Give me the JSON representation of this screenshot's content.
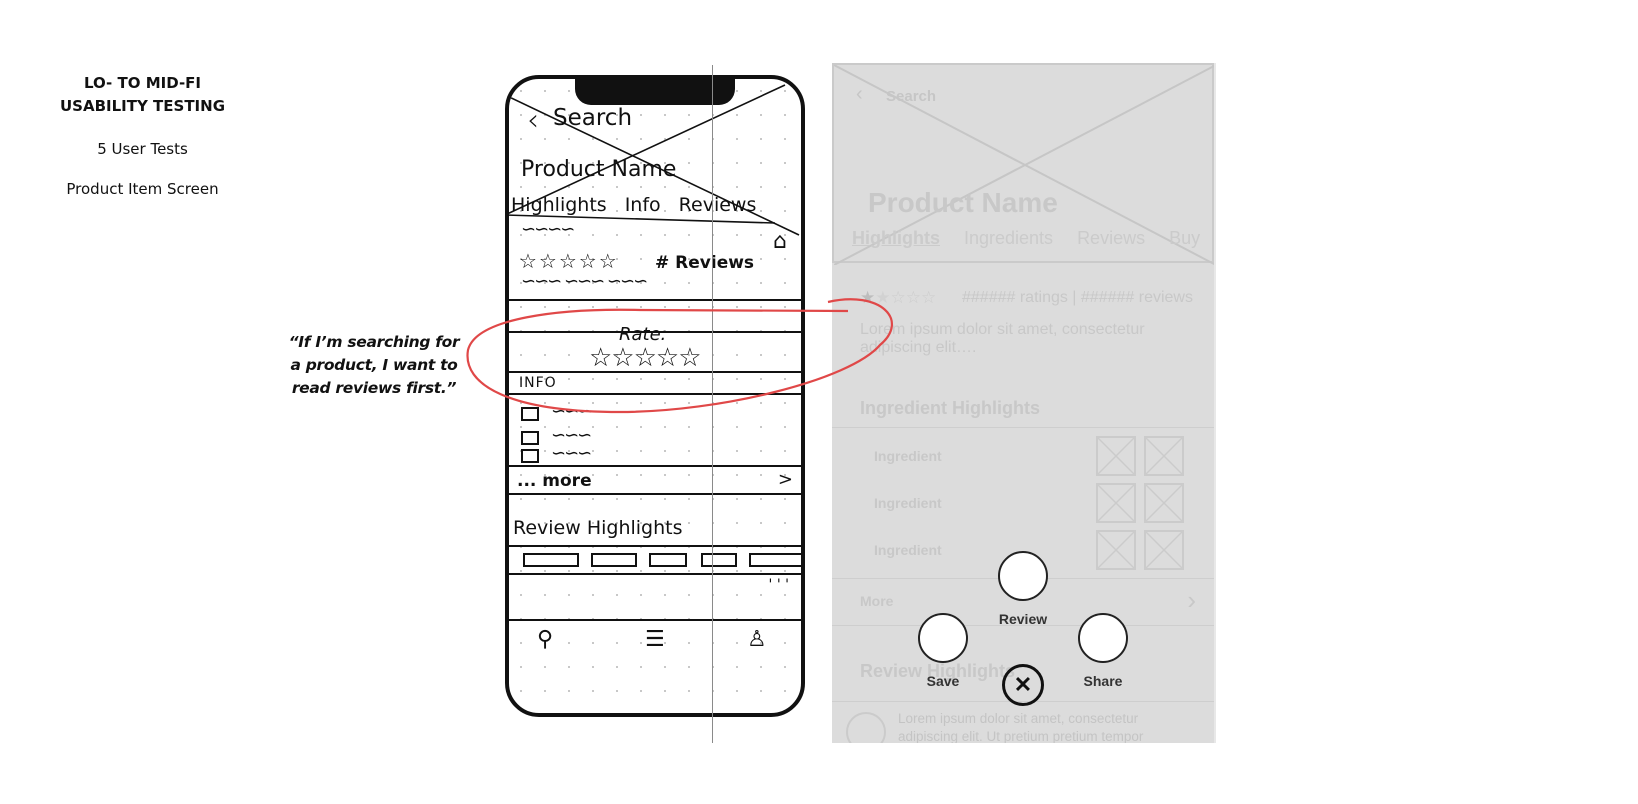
{
  "slide": {
    "title_line1": "LO- TO MID-FI",
    "title_line2": "USABILITY TESTING",
    "tests": "5 User Tests",
    "screen": "Product Item Screen",
    "quote": "“If I’m searching for a product, I want to read reviews first.”",
    "annotation_color": "#e04848"
  },
  "sketch": {
    "back_label": "Search",
    "product_name": "Product Name",
    "tabs": [
      "Highlights",
      "Info",
      "Reviews"
    ],
    "stars": "☆☆☆☆☆",
    "reviews_count": "# Reviews",
    "rate_label": "Rate:",
    "rate_stars": "☆☆☆☆☆",
    "info_label": "INFO",
    "more_label": "... more",
    "more_chevron": ">",
    "review_highlights": "Review Highlights",
    "ellipsis": "' ' '",
    "nav": [
      "search-icon",
      "list-icon",
      "profile-icon"
    ]
  },
  "wireframe": {
    "back_label": "Search",
    "product_name": "Product Name",
    "tabs": [
      {
        "label": "Highlights",
        "active": true
      },
      {
        "label": "Ingredients",
        "active": false
      },
      {
        "label": "Reviews",
        "active": false
      },
      {
        "label": "Buy",
        "active": false
      }
    ],
    "rating": {
      "value": 1.5,
      "max": 5
    },
    "ratings_text": "###### ratings | ###### reviews",
    "description": "Lorem ipsum dolor sit amet, consectetur adipiscing elit….",
    "ingredient_highlights_title": "Ingredient Highlights",
    "ingredients": [
      "Ingredient",
      "Ingredient",
      "Ingredient"
    ],
    "more_label": "More",
    "review_highlights_title": "Review Highlights",
    "review_text": "Lorem ipsum dolor sit amet, consectetur adipiscing elit. Ut pretium pretium tempor",
    "action_menu": {
      "review": "Review",
      "save": "Save",
      "share": "Share",
      "close": "✕"
    }
  }
}
